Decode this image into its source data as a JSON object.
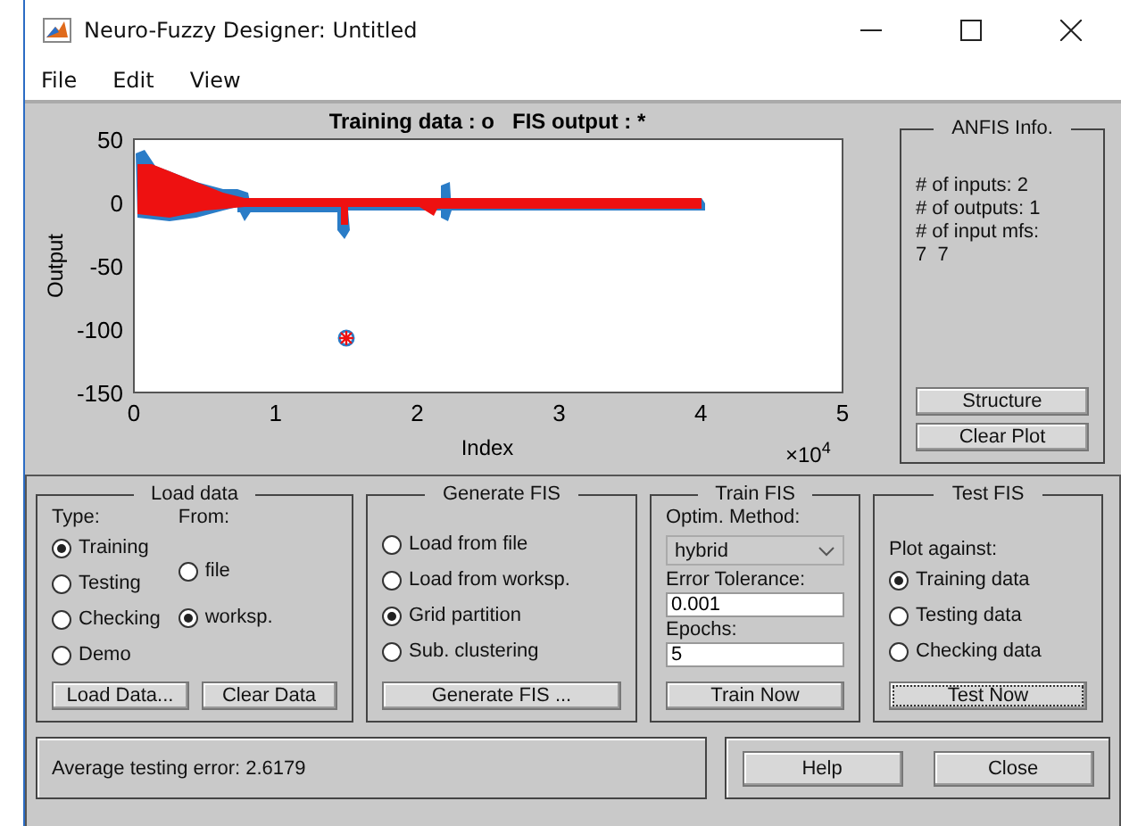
{
  "window": {
    "title": "Neuro-Fuzzy Designer: Untitled"
  },
  "menu": [
    "File",
    "Edit",
    "View"
  ],
  "plot": {
    "title": "Training data : o   FIS output : *",
    "xlabel": "Index",
    "ylabel": "Output",
    "xticks": [
      "0",
      "1",
      "2",
      "3",
      "4",
      "5"
    ],
    "yticks": [
      "50",
      "0",
      "-50",
      "-100",
      "-150"
    ],
    "x_multiplier": {
      "base": "×10",
      "exponent": "4"
    }
  },
  "anfis_info": {
    "title": "ANFIS Info.",
    "lines": [
      "# of inputs: 2",
      "# of outputs: 1",
      "# of input mfs:",
      "7  7"
    ],
    "buttons": [
      "Structure",
      "Clear Plot"
    ]
  },
  "load_data": {
    "title": "Load data",
    "type_label": "Type:",
    "from_label": "From:",
    "types": [
      {
        "label": "Training",
        "selected": true
      },
      {
        "label": "Testing",
        "selected": false
      },
      {
        "label": "Checking",
        "selected": false
      },
      {
        "label": "Demo",
        "selected": false
      }
    ],
    "sources": [
      {
        "label": "file",
        "selected": false
      },
      {
        "label": "worksp.",
        "selected": true
      }
    ],
    "buttons": [
      "Load Data...",
      "Clear Data"
    ]
  },
  "generate_fis": {
    "title": "Generate FIS",
    "options": [
      {
        "label": "Load from file",
        "selected": false
      },
      {
        "label": "Load from worksp.",
        "selected": false
      },
      {
        "label": "Grid partition",
        "selected": true
      },
      {
        "label": "Sub. clustering",
        "selected": false
      }
    ],
    "button": "Generate FIS ..."
  },
  "train_fis": {
    "title": "Train FIS",
    "method_label": "Optim. Method:",
    "method": "hybrid",
    "tolerance_label": "Error Tolerance:",
    "tolerance": "0.001",
    "epochs_label": "Epochs:",
    "epochs": "5",
    "button": "Train Now"
  },
  "test_fis": {
    "title": "Test FIS",
    "plot_against_label": "Plot against:",
    "options": [
      {
        "label": "Training data",
        "selected": true
      },
      {
        "label": "Testing data",
        "selected": false
      },
      {
        "label": "Checking data",
        "selected": false
      }
    ],
    "button": "Test Now"
  },
  "status": "Average testing error: 2.6179",
  "footer_buttons": [
    "Help",
    "Close"
  ]
}
